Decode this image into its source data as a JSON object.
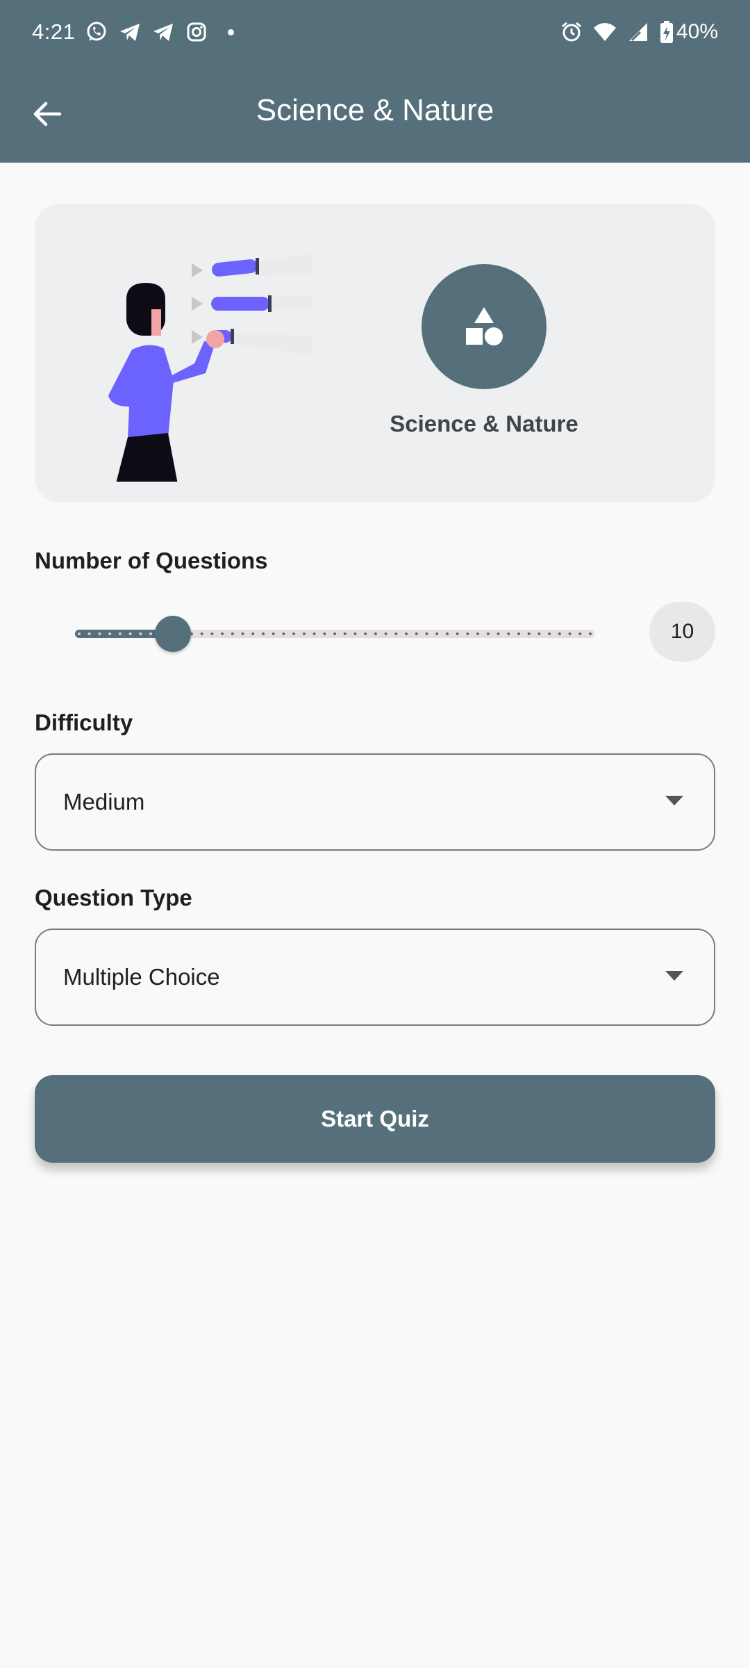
{
  "status_bar": {
    "time": "4:21",
    "battery": "40%",
    "left_icons": [
      "whatsapp-icon",
      "telegram-icon",
      "telegram-icon",
      "instagram-icon",
      "notification-dot-icon"
    ],
    "right_icons": [
      "alarm-icon",
      "wifi-icon",
      "cellular-signal-icon",
      "battery-charging-icon"
    ]
  },
  "app_bar": {
    "back_icon": "arrow-back-icon",
    "title": "Science & Nature"
  },
  "hero": {
    "category_icon": "shapes-icon",
    "category_name": "Science & Nature"
  },
  "questions": {
    "label": "Number of Questions",
    "value": "10",
    "slider_fraction": 0.188
  },
  "difficulty": {
    "label": "Difficulty",
    "selected": "Medium"
  },
  "question_type": {
    "label": "Question Type",
    "selected": "Multiple Choice"
  },
  "start_button": {
    "label": "Start Quiz"
  },
  "colors": {
    "primary": "#56707b",
    "accent_illustration": "#6c63ff",
    "background": "#f9f9f9",
    "card": "#eeeff1"
  }
}
